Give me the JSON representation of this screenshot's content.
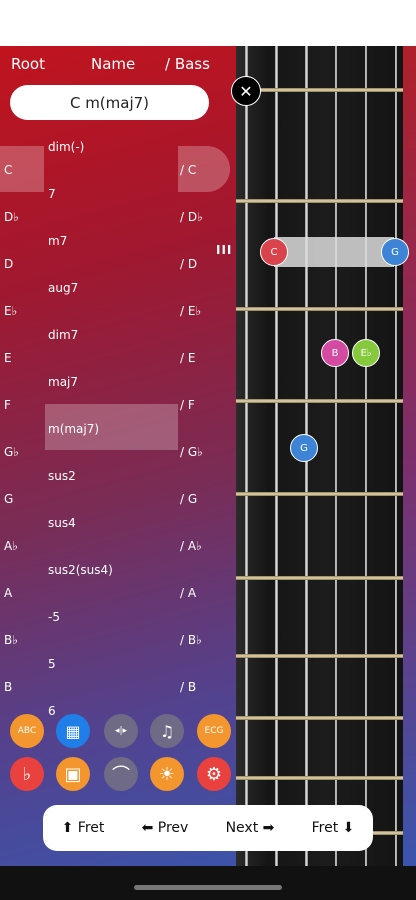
{
  "header": {
    "root": "Root",
    "name": "Name",
    "bass": "/ Bass"
  },
  "chord_display": "C m(maj7)",
  "root_list": [
    "C",
    "D♭",
    "D",
    "E♭",
    "E",
    "F",
    "G♭",
    "G",
    "A♭",
    "A",
    "B♭",
    "B"
  ],
  "selected_root": "C",
  "name_list": [
    "dim(‑)",
    "7",
    "m7",
    "aug7",
    "dim7",
    "maj7",
    "m(maj7)",
    "sus2",
    "sus4",
    "sus2(sus4)",
    "-5",
    "5",
    "6"
  ],
  "selected_name": "m(maj7)",
  "bass_list": [
    "/ C",
    "/ D♭",
    "/ D",
    "/ E♭",
    "/ E",
    "/ F",
    "/ G♭",
    "/ G",
    "/ A♭",
    "/ A",
    "/ B♭",
    "/ B"
  ],
  "selected_bass": "/ C",
  "grip_symbol": "III",
  "close_symbol": "✕",
  "notes": [
    {
      "label": "C",
      "color": "#d9444c",
      "string": 2,
      "fret": 3
    },
    {
      "label": "G",
      "color": "#3d84d6",
      "string": 6,
      "fret": 3
    },
    {
      "label": "B",
      "color": "#d34aa0",
      "string": 4,
      "fret": 4
    },
    {
      "label": "E♭",
      "color": "#86c93d",
      "string": 5,
      "fret": 4
    },
    {
      "label": "G",
      "color": "#3d84d6",
      "string": 3,
      "fret": 5
    }
  ],
  "tools_row1": [
    {
      "name": "notation-icon",
      "text": "ABC",
      "color": "#f4962e"
    },
    {
      "name": "table-icon",
      "text": "▦",
      "color": "#1f7ee8"
    },
    {
      "name": "flip-icon",
      "text": "◂|▸",
      "color": "#6f6a85"
    },
    {
      "name": "music-note-icon",
      "text": "♫",
      "color": "#6f6a85"
    },
    {
      "name": "circle-notes-icon",
      "text": "ECG",
      "color": "#f4962e"
    }
  ],
  "tools_row2": [
    {
      "name": "flat-icon",
      "text": "♭",
      "color": "#e8413e"
    },
    {
      "name": "guitar-icon",
      "text": "▣",
      "color": "#f4962e"
    },
    {
      "name": "harp-icon",
      "text": "⌒",
      "color": "#6f6a85"
    },
    {
      "name": "light-icon",
      "text": "☀",
      "color": "#f4962e"
    },
    {
      "name": "settings-icon",
      "text": "⚙",
      "color": "#e8413e"
    }
  ],
  "nav": {
    "fret_up": "⬆ Fret",
    "prev": "⬅ Prev",
    "next": "Next ➡",
    "fret_down": "Fret ⬇"
  }
}
